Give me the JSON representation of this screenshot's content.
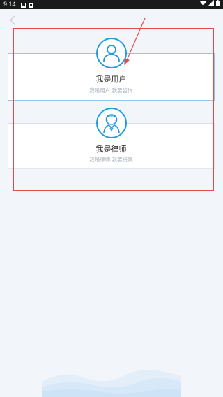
{
  "status_bar": {
    "time": "9:14",
    "left_icons": [
      "image-icon",
      "notification-icon"
    ],
    "right_icons": [
      "wifi-icon",
      "signal-icon",
      "battery-icon"
    ]
  },
  "nav": {
    "back_icon": "chevron-left-icon"
  },
  "roles": [
    {
      "title": "我是用户",
      "subtitle": "我是用户,我要咨询",
      "icon": "user-icon"
    },
    {
      "title": "我是律师",
      "subtitle": "我是律师,我要接案",
      "icon": "lawyer-icon"
    }
  ],
  "colors": {
    "accent": "#1f9be0",
    "selected_border": "#8fc7ee",
    "annotation": "#e54b4b",
    "background": "#f2f5f9"
  }
}
